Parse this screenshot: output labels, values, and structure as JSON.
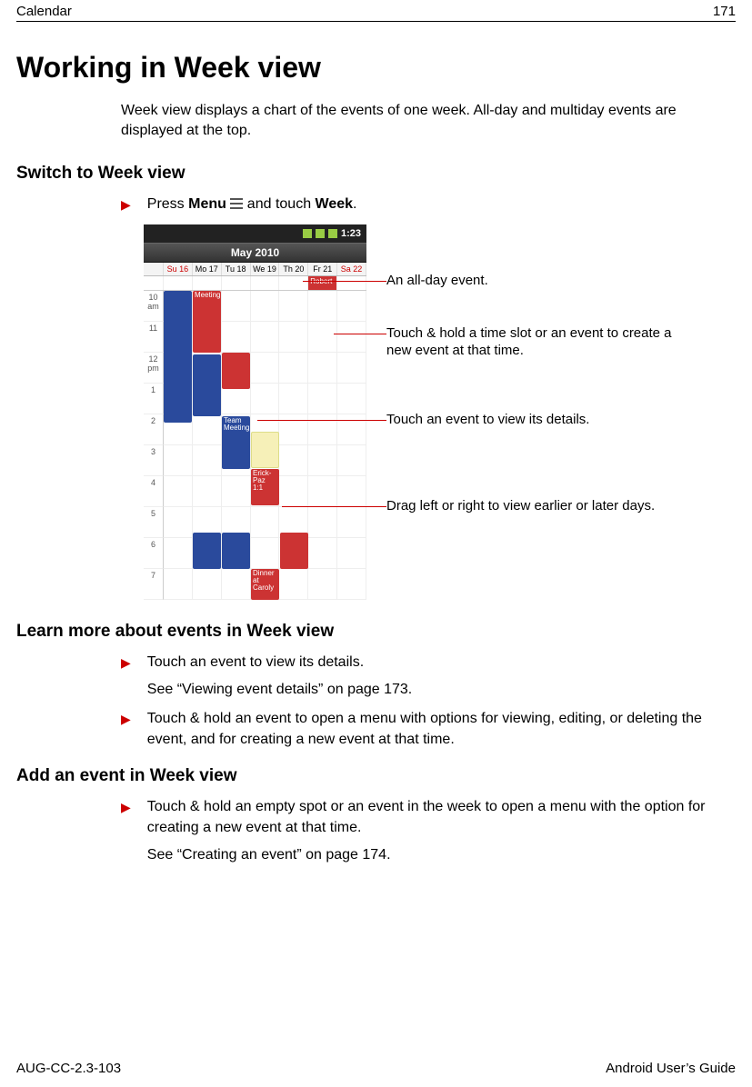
{
  "header": {
    "left": "Calendar",
    "right": "171"
  },
  "title": "Working in Week view",
  "intro": "Week view displays a chart of the events of one week. All-day and multiday events are displayed at the top.",
  "section1": {
    "heading": "Switch to Week view",
    "step_prefix": "Press ",
    "step_bold1": "Menu",
    "step_mid": " and touch ",
    "step_bold2": "Week",
    "step_suffix": "."
  },
  "screenshot": {
    "time": "1:23",
    "month": "May 2010",
    "days": [
      "Su 16",
      "Mo 17",
      "Tu 18",
      "We 19",
      "Th 20",
      "Fr 21",
      "Sa 22"
    ],
    "hours": [
      "10 am",
      "11",
      "12 pm",
      "1",
      "2",
      "3",
      "4",
      "5",
      "6",
      "7"
    ],
    "allday_event": "Robert",
    "events": {
      "meeting": "Meeting",
      "team": "Team Meeting",
      "erick": "Erick-Paz 1:1",
      "dinner": "Dinner at Caroly"
    }
  },
  "callouts": {
    "c1": "An all-day event.",
    "c2": "Touch & hold a time slot or an event to create a new event at that time.",
    "c3": "Touch an event to view its details.",
    "c4": "Drag left or right to view earlier or later days."
  },
  "section2": {
    "heading": "Learn more about events in Week view",
    "b1": "Touch an event to view its details.",
    "b1_sub": "See “Viewing event details” on page 173.",
    "b2": "Touch & hold an event to open a menu with options for viewing, editing, or deleting the event, and for creating a new event at that time."
  },
  "section3": {
    "heading": "Add an event in Week view",
    "b1": "Touch & hold an empty spot or an event in the week to open a menu with the option for creating a new event at that time.",
    "b1_sub": "See “Creating an event” on page 174."
  },
  "footer": {
    "left": "AUG-CC-2.3-103",
    "right": "Android User’s Guide"
  }
}
